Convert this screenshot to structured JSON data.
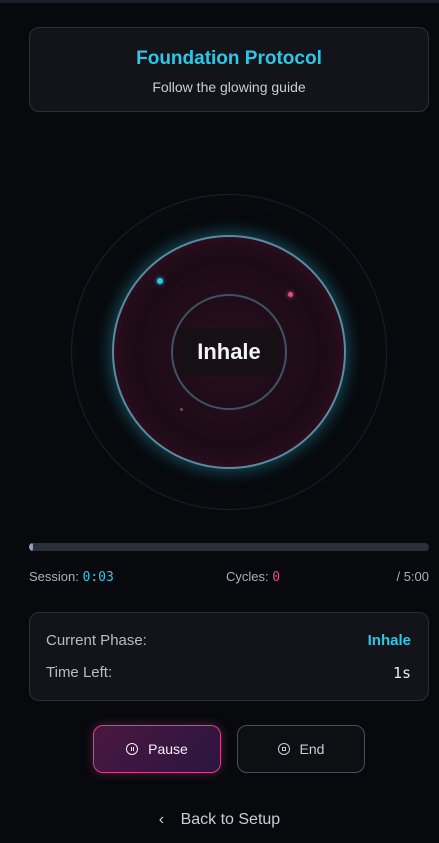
{
  "header": {
    "title": "Foundation Protocol",
    "subtitle": "Follow the glowing guide"
  },
  "breath": {
    "phase_text": "Inhale"
  },
  "progress": {
    "fraction": 0.01
  },
  "stats": {
    "session_label": "Session:",
    "session_value": "0:03",
    "cycles_label": "Cycles:",
    "cycles_value": "0",
    "total": "/ 5:00"
  },
  "phase_card": {
    "current_label": "Current Phase:",
    "current_value": "Inhale",
    "time_label": "Time Left:",
    "time_value": "1s"
  },
  "buttons": {
    "pause": "Pause",
    "end": "End"
  },
  "back": {
    "label": "Back to Setup"
  },
  "icons": {
    "pause": "pause-circle-icon",
    "end": "stop-circle-icon",
    "back": "chevron-left-icon"
  },
  "colors": {
    "accent_cyan": "#2fc7e6",
    "accent_pink": "#e04d8a",
    "background": "#07090d"
  }
}
